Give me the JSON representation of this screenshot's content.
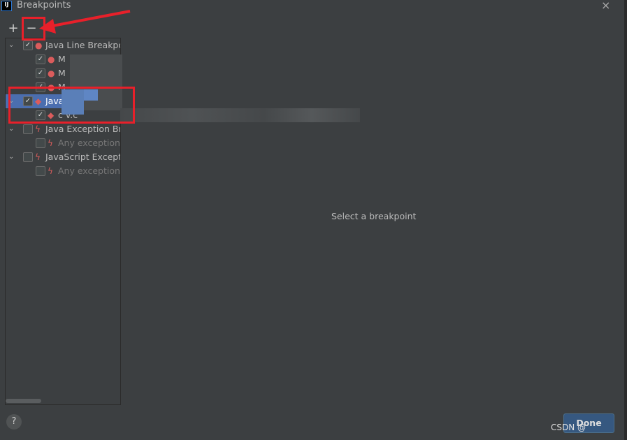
{
  "window": {
    "title": "Breakpoints",
    "logo": "IJ",
    "close": "×"
  },
  "toolbar": {
    "add": "+",
    "remove": "−"
  },
  "tree": [
    {
      "indent": 0,
      "expand": true,
      "checked": true,
      "icon": "line-breakpoint-icon",
      "label": "Java Line Breakpo",
      "selected": false
    },
    {
      "indent": 1,
      "checked": true,
      "icon": "breakpoint-verified-icon",
      "label": "M",
      "selected": false
    },
    {
      "indent": 1,
      "checked": true,
      "icon": "breakpoint-verified-icon",
      "label": "M",
      "selected": false
    },
    {
      "indent": 1,
      "checked": true,
      "icon": "breakpoint-verified-icon",
      "label": "M",
      "selected": false
    },
    {
      "indent": 0,
      "expand": true,
      "checked": true,
      "icon": "method-breakpoint-icon",
      "label": "Java",
      "selected": true
    },
    {
      "indent": 1,
      "checked": true,
      "icon": "method-breakpoint-verified-icon",
      "label": "c                v.c",
      "selected": false
    },
    {
      "indent": 0,
      "expand": true,
      "checked": false,
      "icon": "exception-breakpoint-icon",
      "label": "Java Exception Bre",
      "selected": false
    },
    {
      "indent": 1,
      "checked": false,
      "icon": "exception-breakpoint-icon",
      "label": "Any exception",
      "selected": false,
      "dim": true
    },
    {
      "indent": 0,
      "expand": true,
      "checked": false,
      "icon": "exception-breakpoint-icon",
      "label": "JavaScript Exceptio",
      "selected": false
    },
    {
      "indent": 1,
      "checked": false,
      "icon": "exception-breakpoint-icon",
      "label": "Any exception",
      "selected": false,
      "dim": true
    }
  ],
  "main": {
    "empty_text": "Select a breakpoint"
  },
  "footer": {
    "help": "?",
    "done": "Done",
    "watermark": "CSDN @"
  },
  "colors": {
    "selection": "#4b6eaf",
    "annotation": "#e8202a",
    "breakpoint": "#db5c5c",
    "done": "#365880"
  }
}
